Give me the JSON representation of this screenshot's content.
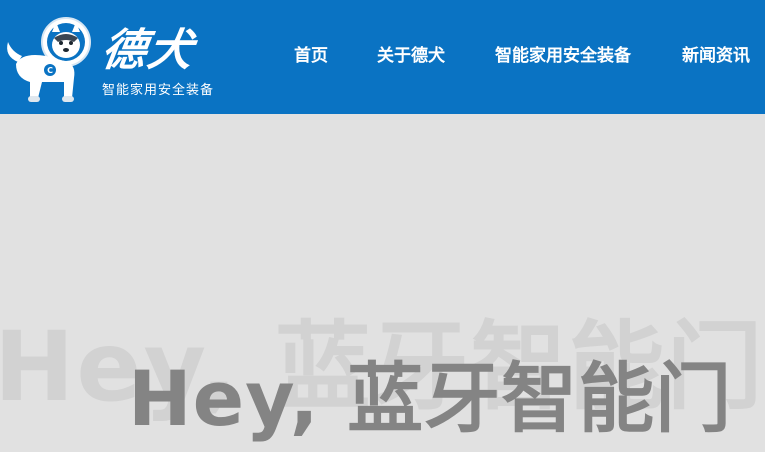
{
  "brand": {
    "name": "德犬",
    "tagline": "智能家用安全装备",
    "logo_icon": "astronaut-dog-icon"
  },
  "nav": {
    "items": [
      {
        "label": "首页"
      },
      {
        "label": "关于德犬"
      },
      {
        "label": "智能家用安全装备"
      },
      {
        "label": "新闻资讯"
      }
    ]
  },
  "hero": {
    "ghost_text": "Hey, 蓝牙智能门",
    "title": "Hey, 蓝牙智能门"
  },
  "colors": {
    "header_bg": "#0a73c3",
    "hero_bg": "#e1e1e1",
    "hero_text": "#848484",
    "ghost_text": "#d2d2d2"
  }
}
